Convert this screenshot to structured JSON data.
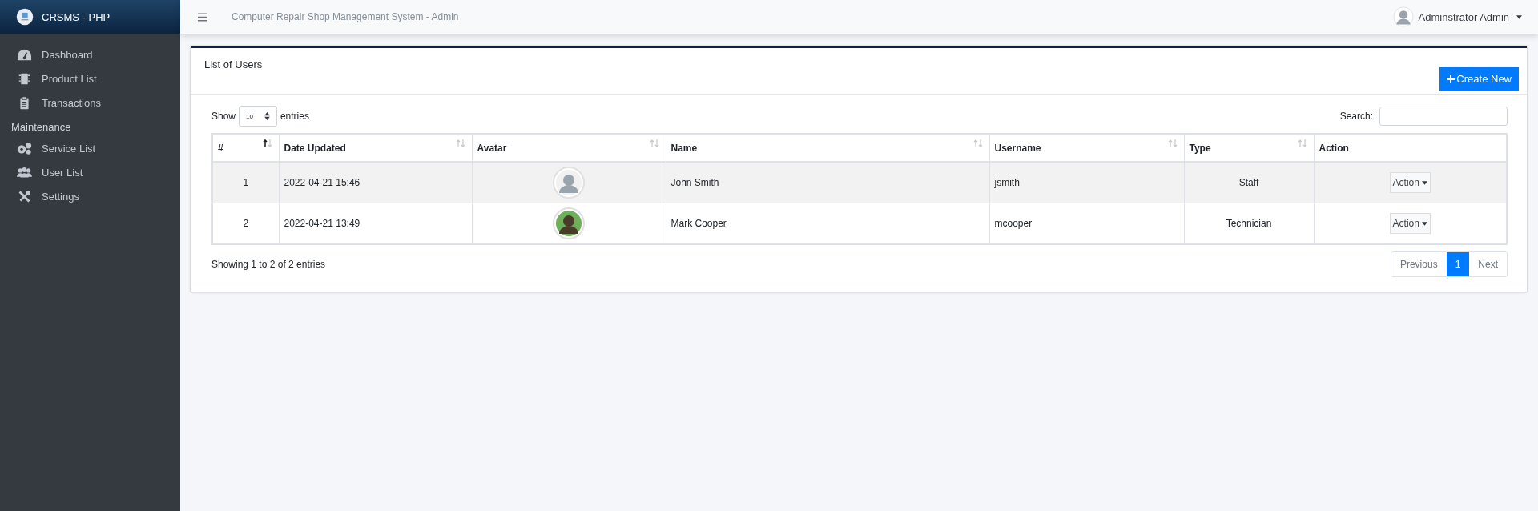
{
  "brand": {
    "title": "CRSMS - PHP"
  },
  "sidebar": {
    "items": [
      {
        "label": "Dashboard",
        "kind": "link"
      },
      {
        "label": "Product List",
        "kind": "link"
      },
      {
        "label": "Transactions",
        "kind": "link"
      },
      {
        "label": "Maintenance",
        "kind": "header"
      },
      {
        "label": "Service List",
        "kind": "link"
      },
      {
        "label": "User List",
        "kind": "link"
      },
      {
        "label": "Settings",
        "kind": "link"
      }
    ]
  },
  "topbar": {
    "title": "Computer Repair Shop Management System - Admin",
    "user": "Adminstrator Admin"
  },
  "card": {
    "title": "List of Users",
    "create_button": "Create New"
  },
  "table": {
    "length_label_before": "Show",
    "length_value": "10",
    "length_label_after": "entries",
    "search_label": "Search:",
    "columns": [
      {
        "label": "#",
        "sortable": true,
        "sorted": true
      },
      {
        "label": "Date Updated",
        "sortable": true,
        "sorted": false
      },
      {
        "label": "Avatar",
        "sortable": true,
        "sorted": false
      },
      {
        "label": "Name",
        "sortable": true,
        "sorted": false
      },
      {
        "label": "Username",
        "sortable": true,
        "sorted": false
      },
      {
        "label": "Type",
        "sortable": true,
        "sorted": false
      },
      {
        "label": "Action",
        "sortable": false
      }
    ],
    "rows": [
      {
        "num": "1",
        "date": "2022-04-21 15:46",
        "name": "John Smith",
        "username": "jsmith",
        "type": "Staff",
        "action": "Action"
      },
      {
        "num": "2",
        "date": "2022-04-21 13:49",
        "name": "Mark Cooper",
        "username": "mcooper",
        "type": "Technician",
        "action": "Action"
      }
    ],
    "info": "Showing 1 to 2 of 2 entries",
    "pagination": [
      {
        "label": "Previous",
        "selected": false,
        "disabled": true
      },
      {
        "label": "1",
        "selected": true,
        "disabled": false
      },
      {
        "label": "Next",
        "selected": false,
        "disabled": true
      }
    ]
  }
}
